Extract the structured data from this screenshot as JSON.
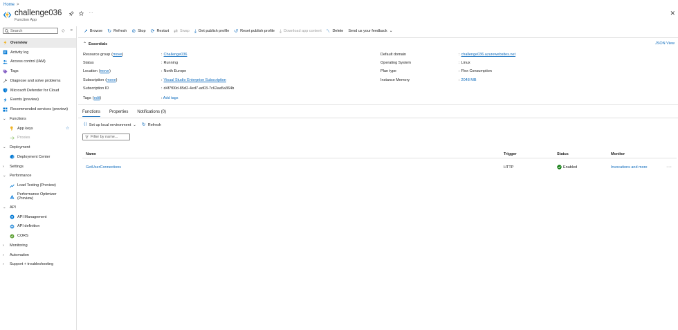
{
  "breadcrumb": {
    "home": "Home",
    "sep": ">"
  },
  "header": {
    "title": "challenge036",
    "subtitle": "Function App",
    "pin_icon": "pin-icon",
    "star_icon": "star-icon",
    "more": "···",
    "close": "✕"
  },
  "sidebar": {
    "search_placeholder": "Search",
    "tools": [
      "◇",
      "«"
    ],
    "items": [
      {
        "label": "Overview",
        "icon": "lightning-icon",
        "type": "top",
        "active": true
      },
      {
        "label": "Activity log",
        "icon": "activity-log-icon",
        "type": "top"
      },
      {
        "label": "Access control (IAM)",
        "icon": "people-icon",
        "type": "top"
      },
      {
        "label": "Tags",
        "icon": "tag-icon",
        "type": "top"
      },
      {
        "label": "Diagnose and solve problems",
        "icon": "wrench-icon",
        "type": "top"
      },
      {
        "label": "Microsoft Defender for Cloud",
        "icon": "shield-icon",
        "type": "top"
      },
      {
        "label": "Events (preview)",
        "icon": "lightning-events-icon",
        "type": "top"
      },
      {
        "label": "Recommended services (preview)",
        "icon": "grid-icon",
        "type": "top"
      },
      {
        "label": "Functions",
        "icon": "chevron-down-icon",
        "type": "group"
      },
      {
        "label": "App keys",
        "icon": "key-icon",
        "type": "sub",
        "star": true
      },
      {
        "label": "Proxies",
        "icon": "proxy-icon",
        "type": "sub",
        "disabled": true
      },
      {
        "label": "Deployment",
        "icon": "chevron-down-icon",
        "type": "group"
      },
      {
        "label": "Deployment Center",
        "icon": "cube-icon",
        "type": "sub"
      },
      {
        "label": "Settings",
        "icon": "chevron-right-icon",
        "type": "group"
      },
      {
        "label": "Performance",
        "icon": "chevron-down-icon",
        "type": "group"
      },
      {
        "label": "Load Testing (Preview)",
        "icon": "load-test-icon",
        "type": "sub"
      },
      {
        "label": "Performance Optimizer (Preview)",
        "icon": "optimizer-icon",
        "type": "sub",
        "double": true
      },
      {
        "label": "API",
        "icon": "chevron-down-icon",
        "type": "group"
      },
      {
        "label": "API Management",
        "icon": "api-management-icon",
        "type": "sub"
      },
      {
        "label": "API definition",
        "icon": "api-definition-icon",
        "type": "sub"
      },
      {
        "label": "CORS",
        "icon": "cors-icon",
        "type": "sub"
      },
      {
        "label": "Monitoring",
        "icon": "chevron-right-icon",
        "type": "group"
      },
      {
        "label": "Automation",
        "icon": "chevron-right-icon",
        "type": "group"
      },
      {
        "label": "Support + troubleshooting",
        "icon": "chevron-right-icon",
        "type": "group"
      }
    ]
  },
  "toolbar": {
    "items": [
      {
        "label": "Browse",
        "icon": "browse-icon",
        "glyph": "↗"
      },
      {
        "label": "Refresh",
        "icon": "refresh-icon",
        "glyph": "↻"
      },
      {
        "label": "Stop",
        "icon": "stop-icon",
        "glyph": "⊘"
      },
      {
        "label": "Restart",
        "icon": "restart-icon",
        "glyph": "⟳"
      },
      {
        "label": "Swap",
        "icon": "swap-icon",
        "glyph": "⇄",
        "disabled": true
      },
      {
        "label": "Get publish profile",
        "icon": "download-icon",
        "glyph": "⤓"
      },
      {
        "label": "Reset publish profile",
        "icon": "reset-icon",
        "glyph": "↺"
      },
      {
        "label": "Download app content",
        "icon": "download-content-icon",
        "glyph": "⤓",
        "disabled": true
      },
      {
        "label": "Delete",
        "icon": "trash-icon",
        "glyph": "␡"
      },
      {
        "label": "Send us your feedback",
        "icon": "chevron-down-icon",
        "glyph": "⌄",
        "trailing": true
      }
    ]
  },
  "essentials": {
    "heading": "Essentials",
    "json_view": "JSON View",
    "left": [
      {
        "label": "Resource group",
        "move": "move",
        "value": "Challenge036",
        "link": true
      },
      {
        "label": "Status",
        "value": "Running"
      },
      {
        "label": "Location",
        "move": "move",
        "value": "North Europe"
      },
      {
        "label": "Subscription",
        "move": "move",
        "value": "Visual Studio Enterprise Subscription",
        "link": true
      },
      {
        "label": "Subscription ID",
        "value": "d4f7f00d-85d2-4ed7-ad03-7c62aa5a364b"
      }
    ],
    "right": [
      {
        "label": "Default domain",
        "value": "challenge036.azurewebsites.net",
        "link": true
      },
      {
        "label": "Operating System",
        "value": "Linux"
      },
      {
        "label": "Plan type",
        "value": "Flex Consumption"
      },
      {
        "label": "Instance Memory",
        "value": "2048 MB",
        "plainlink": true
      }
    ],
    "tags": {
      "label": "Tags",
      "edit": "edit",
      "value": "Add tags"
    }
  },
  "tabs": [
    {
      "label": "Functions",
      "active": true
    },
    {
      "label": "Properties"
    },
    {
      "label": "Notifications (0)"
    }
  ],
  "functions": {
    "setup_label": "Set up local environment",
    "refresh_label": "Refresh",
    "filter_placeholder": "Filter by name...",
    "columns": {
      "name": "Name",
      "trigger": "Trigger",
      "status": "Status",
      "monitor": "Monitor"
    },
    "rows": [
      {
        "name": "GetUserConnections",
        "trigger": "HTTP",
        "status": "Enabled",
        "monitor": "Invocations and more",
        "more": "···"
      }
    ]
  },
  "colors": {
    "accent": "#0f6cbd",
    "success": "#107c10",
    "function_icon": "#f0b323"
  }
}
